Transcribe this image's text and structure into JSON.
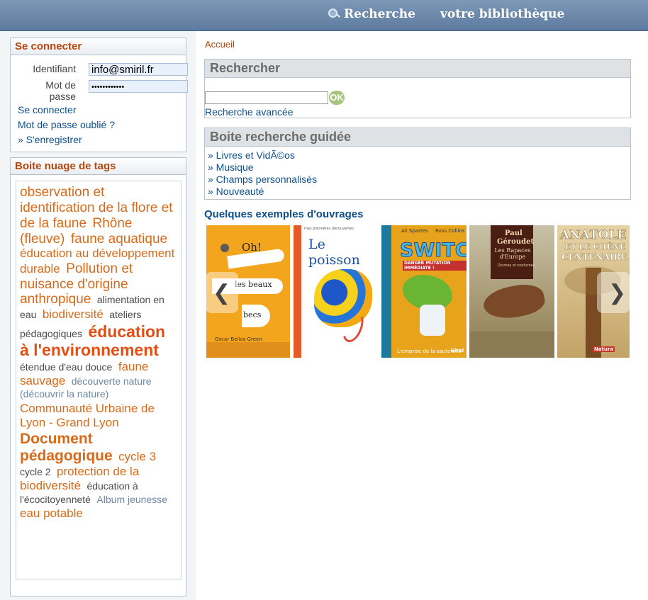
{
  "topnav": {
    "search_label": "Recherche",
    "library_label": "votre bibliothèque"
  },
  "login": {
    "title": "Se connecter",
    "identifiant_label": "Identifiant",
    "identifiant_value": "info@smiril.fr",
    "password_label_1": "Mot de",
    "password_label_2": "passe",
    "password_value": "••••••••••••",
    "login_link": "Se connecter",
    "forgot_link": "Mot de passe oublié ?",
    "register_link": "» S'enregistrer"
  },
  "tags": {
    "title": "Boite nuage de tags",
    "items": [
      "observation et identification de la flore et de la faune",
      "Rhône (fleuve)",
      "faune aquatique",
      "éducation au développement durable",
      "Pollution et nuisance d'origine anthropique",
      "alimentation en eau",
      "biodiversité",
      "ateliers pédagogiques",
      "éducation à l'environnement",
      "étendue d'eau douce",
      "faune sauvage",
      "découverte nature (découvrir la nature)",
      "Communauté Urbaine de Lyon - Grand Lyon",
      "Document pédagogique",
      "cycle 3",
      "cycle 2",
      "protection de la biodiversité",
      "éducation à l'écocitoyenneté",
      "Album jeunesse",
      "eau potable"
    ]
  },
  "breadcrumb": "Accueil",
  "search": {
    "title": "Rechercher",
    "ok_label": "OK",
    "advanced_link": "Recherche avancée"
  },
  "guided": {
    "title": "Boite recherche guidée",
    "links": [
      "» Livres et VidÃ©os",
      "» Musique",
      "» Champs personnalisés",
      "» Nouveauté"
    ]
  },
  "examples": {
    "title": "Quelques exemples d'ouvrages",
    "books": [
      {
        "line1": "Oh!",
        "line2": "les beaux",
        "line3": "becs",
        "author": "Oscar Bellos Green"
      },
      {
        "series": "mes premières découvertes",
        "title": "Le poisson"
      },
      {
        "author1": "Ali Spartes",
        "author2": "Ross Collins",
        "title": "SWITCH",
        "subtitle": "DANGER MUTATION IMMÉDIATE !",
        "bottom": "L'emprise de la sauterelle",
        "publisher": "Sirol"
      },
      {
        "author_first": "Paul",
        "author_last": "Géroudet",
        "title": "Les Rapaces d'Europe",
        "subtitle": "Diurnes et nocturnes"
      },
      {
        "line1": "ANATOLE",
        "line2": "ET LE CHÊNE",
        "line3": "CENTENAIRE",
        "publisher": "Natura"
      }
    ]
  },
  "colors": {
    "accent": "#b8460b",
    "link": "#0f4f8a",
    "topbar": "#6a88ab"
  }
}
